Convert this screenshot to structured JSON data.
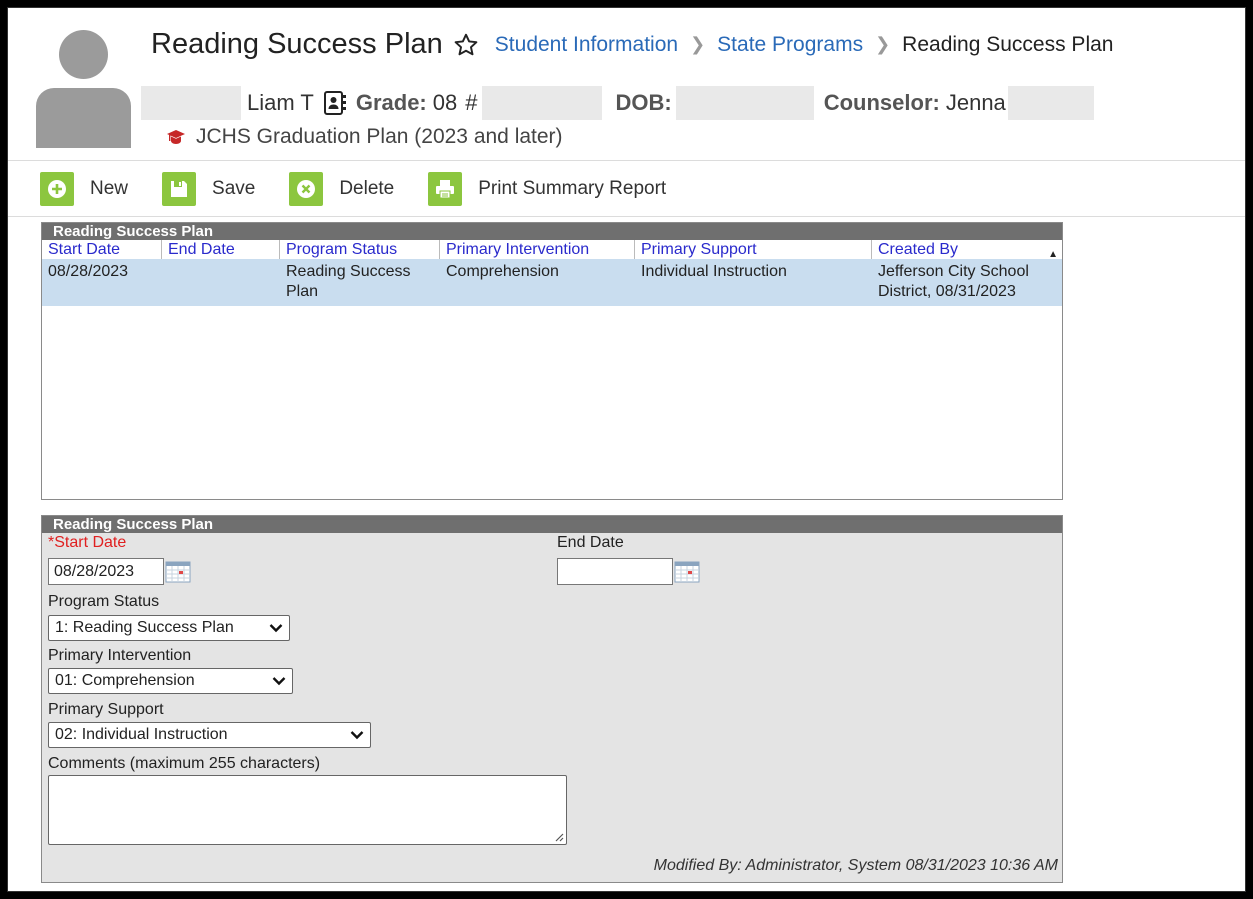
{
  "header": {
    "title": "Reading Success Plan",
    "breadcrumbs": [
      "Student Information",
      "State Programs"
    ],
    "current_crumb": "Reading Success Plan",
    "student_name": "Liam T",
    "grade_label": "Grade:",
    "grade_value": "08",
    "id_label": "#",
    "dob_label": "DOB:",
    "counselor_label": "Counselor:",
    "counselor_value": "Jenna",
    "plan": "JCHS Graduation Plan (2023 and later)"
  },
  "toolbar": {
    "new_label": "New",
    "save_label": "Save",
    "delete_label": "Delete",
    "print_label": "Print Summary Report"
  },
  "list": {
    "title": "Reading Success Plan",
    "columns": [
      "Start Date",
      "End Date",
      "Program Status",
      "Primary Intervention",
      "Primary Support",
      "Created By"
    ],
    "rows": [
      {
        "start_date": "08/28/2023",
        "end_date": "",
        "program_status": "Reading Success Plan",
        "primary_intervention": "Comprehension",
        "primary_support": "Individual Instruction",
        "created_by": "Jefferson City School District, 08/31/2023"
      }
    ]
  },
  "form": {
    "title": "Reading Success Plan",
    "start_date_label": "Start Date",
    "start_date_required": "*",
    "start_date_value": "08/28/2023",
    "end_date_label": "End Date",
    "end_date_value": "",
    "program_status_label": "Program Status",
    "program_status_value": "1: Reading Success Plan",
    "primary_intervention_label": "Primary Intervention",
    "primary_intervention_value": "01: Comprehension",
    "primary_support_label": "Primary Support",
    "primary_support_value": "02: Individual Instruction",
    "comments_label": "Comments (maximum 255 characters)",
    "comments_value": "",
    "modified_by": "Modified By: Administrator, System 08/31/2023 10:36 AM"
  },
  "colors": {
    "accent_green": "#8cc63f",
    "link_blue": "#2a6ab8",
    "selected_row": "#c9ddef",
    "panel_header": "#6f6f6f"
  }
}
